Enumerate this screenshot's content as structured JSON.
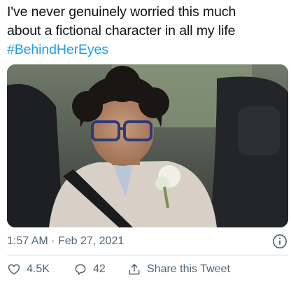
{
  "tweet": {
    "lines": [
      "I've never genuinely worried this much",
      "about a fictional character in all my life"
    ],
    "hashtag": "#BehindHerEyes"
  },
  "meta": {
    "time": "1:57 AM",
    "separator": "·",
    "date": "Feb 27, 2021"
  },
  "actions": {
    "likes": "4.5K",
    "replies": "42",
    "share_label": "Share this Tweet"
  },
  "icons": [
    "info-icon",
    "heart-icon",
    "reply-icon",
    "share-icon"
  ],
  "colors": {
    "accent": "#1d9bf0",
    "meta": "#536471",
    "text": "#0f1419"
  }
}
